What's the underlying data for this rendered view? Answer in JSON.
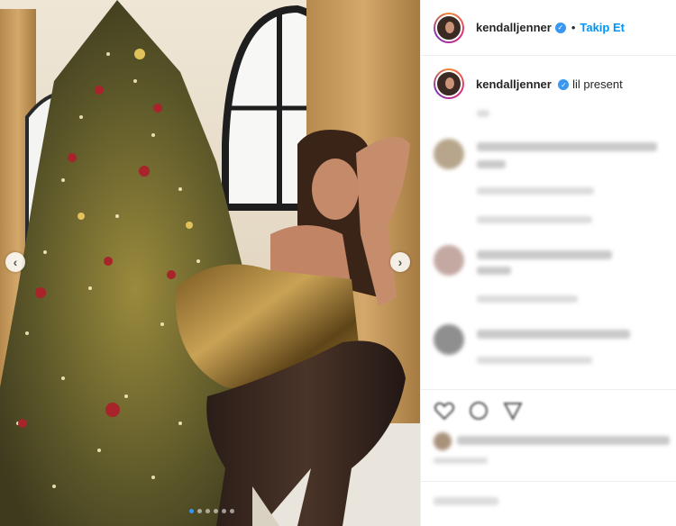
{
  "post": {
    "media": {
      "carousel_dots": 6,
      "active_dot": 0,
      "prev_arrow": "‹",
      "next_arrow": "›"
    },
    "header": {
      "username": "kendalljenner",
      "verified": true,
      "separator": "•",
      "follow_label": "Takip Et"
    },
    "caption": {
      "username": "kendalljenner",
      "text": "lil present"
    },
    "colors": {
      "link_blue": "#0095f6",
      "verified_blue": "#3897f0",
      "text": "#262626",
      "border": "#efefef"
    }
  }
}
